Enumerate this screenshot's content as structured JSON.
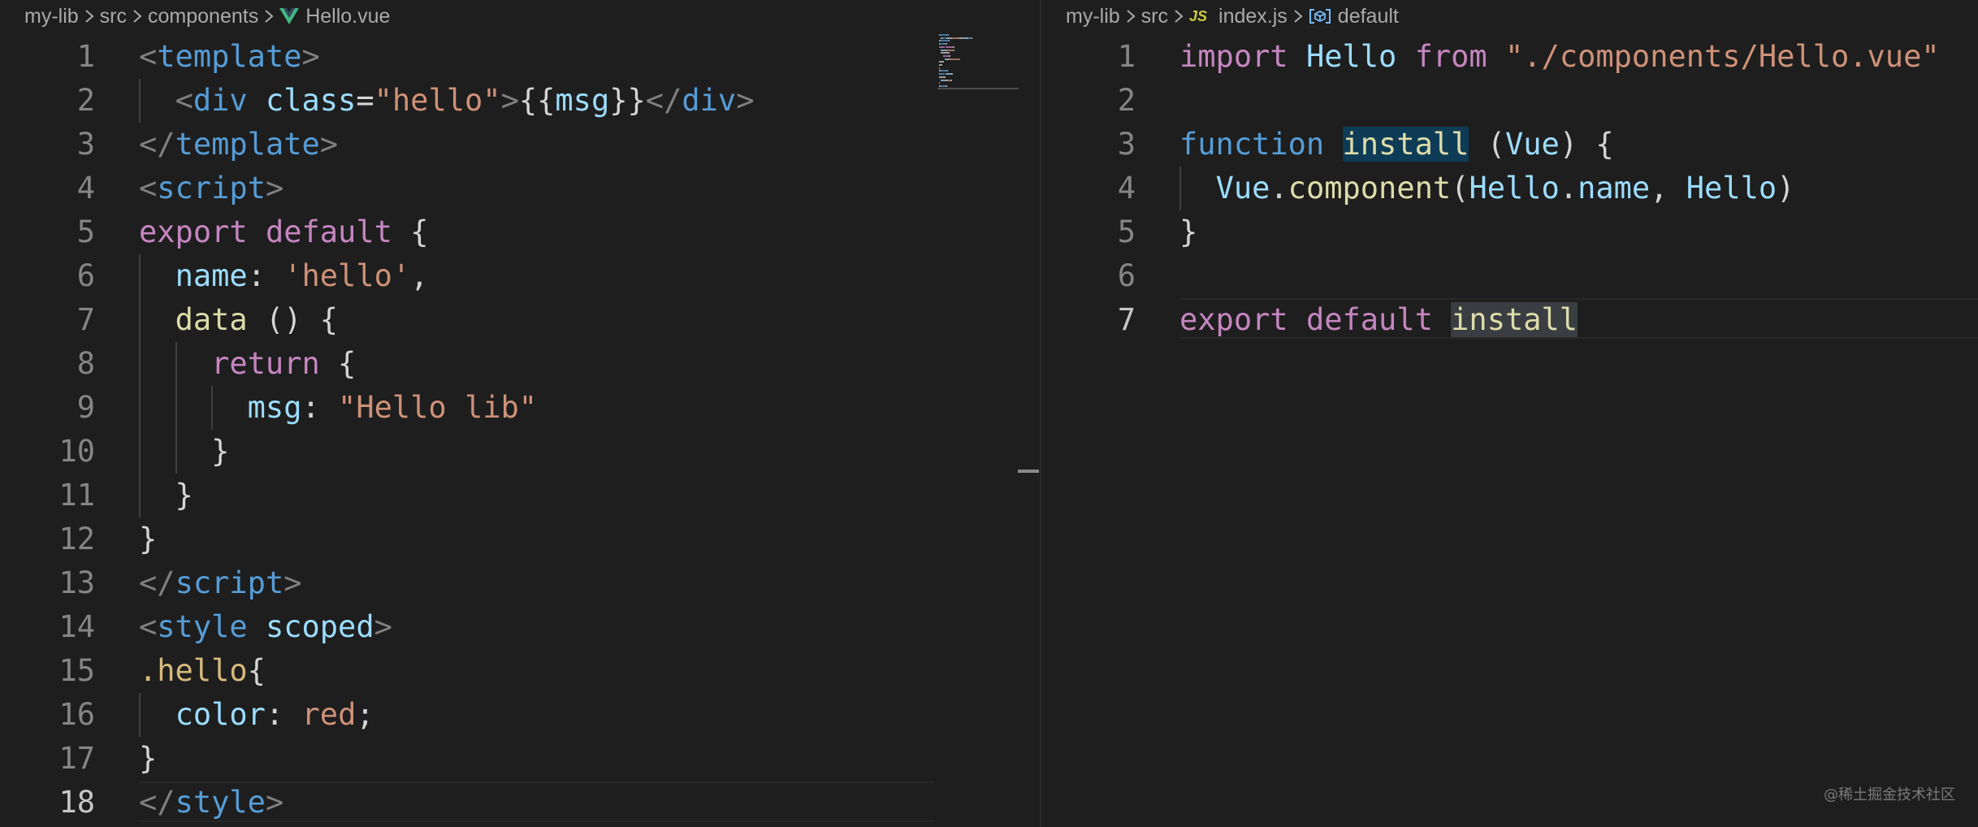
{
  "left_editor": {
    "breadcrumb": [
      "my-lib",
      "src",
      "components",
      "Hello.vue"
    ],
    "file_icon": "vue-logo-icon",
    "active_line": 18,
    "lines": [
      {
        "n": "1",
        "tokens": [
          [
            "t-punc",
            "<"
          ],
          [
            "t-tag",
            "template"
          ],
          [
            "t-punc",
            ">"
          ]
        ]
      },
      {
        "n": "2",
        "tokens": [
          [
            "t-plain",
            "  "
          ],
          [
            "t-punc",
            "<"
          ],
          [
            "t-tag",
            "div"
          ],
          [
            "t-plain",
            " "
          ],
          [
            "t-attr",
            "class"
          ],
          [
            "t-plain",
            "="
          ],
          [
            "t-str",
            "\"hello\""
          ],
          [
            "t-punc",
            ">"
          ],
          [
            "t-plain",
            "{{"
          ],
          [
            "t-var",
            "msg"
          ],
          [
            "t-plain",
            "}}"
          ],
          [
            "t-punc",
            "</"
          ],
          [
            "t-tag",
            "div"
          ],
          [
            "t-punc",
            ">"
          ]
        ]
      },
      {
        "n": "3",
        "tokens": [
          [
            "t-punc",
            "</"
          ],
          [
            "t-tag",
            "template"
          ],
          [
            "t-punc",
            ">"
          ]
        ]
      },
      {
        "n": "4",
        "tokens": [
          [
            "t-punc",
            "<"
          ],
          [
            "t-tag",
            "script"
          ],
          [
            "t-punc",
            ">"
          ]
        ]
      },
      {
        "n": "5",
        "tokens": [
          [
            "t-kw",
            "export"
          ],
          [
            "t-plain",
            " "
          ],
          [
            "t-kw",
            "default"
          ],
          [
            "t-plain",
            " {"
          ]
        ]
      },
      {
        "n": "6",
        "tokens": [
          [
            "t-plain",
            "  "
          ],
          [
            "t-var",
            "name"
          ],
          [
            "t-plain",
            ": "
          ],
          [
            "t-str",
            "'hello'"
          ],
          [
            "t-plain",
            ","
          ]
        ]
      },
      {
        "n": "7",
        "tokens": [
          [
            "t-plain",
            "  "
          ],
          [
            "t-fn",
            "data"
          ],
          [
            "t-plain",
            " () {"
          ]
        ]
      },
      {
        "n": "8",
        "tokens": [
          [
            "t-plain",
            "    "
          ],
          [
            "t-kw",
            "return"
          ],
          [
            "t-plain",
            " {"
          ]
        ]
      },
      {
        "n": "9",
        "tokens": [
          [
            "t-plain",
            "      "
          ],
          [
            "t-var",
            "msg"
          ],
          [
            "t-plain",
            ": "
          ],
          [
            "t-str",
            "\"Hello lib\""
          ]
        ]
      },
      {
        "n": "10",
        "tokens": [
          [
            "t-plain",
            "    }"
          ]
        ]
      },
      {
        "n": "11",
        "tokens": [
          [
            "t-plain",
            "  }"
          ]
        ]
      },
      {
        "n": "12",
        "tokens": [
          [
            "t-plain",
            "}"
          ]
        ]
      },
      {
        "n": "13",
        "tokens": [
          [
            "t-punc",
            "</"
          ],
          [
            "t-tag",
            "script"
          ],
          [
            "t-punc",
            ">"
          ]
        ]
      },
      {
        "n": "14",
        "tokens": [
          [
            "t-punc",
            "<"
          ],
          [
            "t-tag",
            "style"
          ],
          [
            "t-plain",
            " "
          ],
          [
            "t-attr",
            "scoped"
          ],
          [
            "t-punc",
            ">"
          ]
        ]
      },
      {
        "n": "15",
        "tokens": [
          [
            "t-sel",
            ".hello"
          ],
          [
            "t-plain",
            "{"
          ]
        ]
      },
      {
        "n": "16",
        "tokens": [
          [
            "t-plain",
            "  "
          ],
          [
            "t-attr",
            "color"
          ],
          [
            "t-plain",
            ": "
          ],
          [
            "t-str",
            "red"
          ],
          [
            "t-plain",
            ";"
          ]
        ]
      },
      {
        "n": "17",
        "tokens": [
          [
            "t-plain",
            "}"
          ]
        ]
      },
      {
        "n": "18",
        "tokens": [
          [
            "t-punc",
            "</"
          ],
          [
            "t-tag",
            "style"
          ],
          [
            "t-punc",
            ">"
          ]
        ]
      }
    ]
  },
  "right_editor": {
    "breadcrumb": [
      "my-lib",
      "src",
      "index.js",
      "default"
    ],
    "file_icon_text": "JS",
    "symbol_icon": "symbol-variable-icon",
    "active_line": 7,
    "lines": [
      {
        "n": "1",
        "tokens": [
          [
            "t-kw",
            "import"
          ],
          [
            "t-plain",
            " "
          ],
          [
            "t-var",
            "Hello"
          ],
          [
            "t-plain",
            " "
          ],
          [
            "t-kw",
            "from"
          ],
          [
            "t-plain",
            " "
          ],
          [
            "t-str",
            "\"./components/Hello.vue\""
          ]
        ]
      },
      {
        "n": "2",
        "tokens": []
      },
      {
        "n": "3",
        "tokens": [
          [
            "t-storage",
            "function"
          ],
          [
            "t-plain",
            " "
          ],
          [
            "t-fn hl-word",
            "install"
          ],
          [
            "t-plain",
            " ("
          ],
          [
            "t-var",
            "Vue"
          ],
          [
            "t-plain",
            ") {"
          ]
        ]
      },
      {
        "n": "4",
        "tokens": [
          [
            "t-plain",
            "  "
          ],
          [
            "t-var",
            "Vue"
          ],
          [
            "t-plain",
            "."
          ],
          [
            "t-fn",
            "component"
          ],
          [
            "t-plain",
            "("
          ],
          [
            "t-var",
            "Hello"
          ],
          [
            "t-plain",
            "."
          ],
          [
            "t-var",
            "name"
          ],
          [
            "t-plain",
            ", "
          ],
          [
            "t-var",
            "Hello"
          ],
          [
            "t-plain",
            ")"
          ]
        ]
      },
      {
        "n": "5",
        "tokens": [
          [
            "t-plain",
            "}"
          ]
        ]
      },
      {
        "n": "6",
        "tokens": []
      },
      {
        "n": "7",
        "tokens": [
          [
            "t-kw",
            "export"
          ],
          [
            "t-plain",
            " "
          ],
          [
            "t-kw",
            "default"
          ],
          [
            "t-plain",
            " "
          ],
          [
            "t-fn hl-sel",
            "install"
          ]
        ]
      }
    ]
  },
  "watermark": "@稀土掘金技术社区",
  "colors": {
    "background": "#1e1e1e",
    "line_number": "#858585",
    "keyword": "#c586c0",
    "tag": "#569cd6",
    "string": "#ce9178",
    "variable": "#9cdcfe",
    "function": "#dcdcaa",
    "vue_green": "#41b883",
    "js_yellow": "#cbcb41"
  }
}
